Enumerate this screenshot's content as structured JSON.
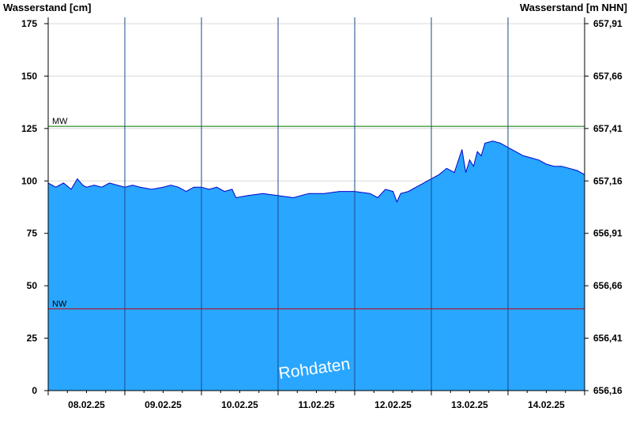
{
  "chart_data": {
    "type": "area",
    "ylabel": "Wasserstand [cm]",
    "ylabel_right": "Wasserstand [m NHN]",
    "ylim": [
      0,
      178
    ],
    "yticks": [
      0,
      25,
      50,
      75,
      100,
      125,
      150,
      175
    ],
    "yticks_right": [
      "656,16",
      "656,41",
      "656,66",
      "656,91",
      "657,16",
      "657,41",
      "657,66",
      "657,91"
    ],
    "x_dates": [
      "08.02.25",
      "09.02.25",
      "10.02.25",
      "11.02.25",
      "12.02.25",
      "13.02.25",
      "14.02.25"
    ],
    "xlim_days": [
      0,
      7
    ],
    "grid": true,
    "fill_color": "#29a6ff",
    "line_color": "#0000cc",
    "reference_lines": [
      {
        "label": "MW",
        "value": 126,
        "color": "#007000"
      },
      {
        "label": "NW",
        "value": 39,
        "color": "#cc0000"
      }
    ],
    "watermark": "Rohdaten",
    "series": [
      {
        "x": [
          0.0,
          0.1,
          0.2,
          0.3,
          0.38,
          0.45,
          0.5,
          0.6,
          0.7,
          0.8,
          0.9,
          1.0,
          1.1,
          1.2,
          1.35,
          1.5,
          1.6,
          1.7,
          1.8,
          1.9,
          2.0,
          2.1,
          2.2,
          2.3,
          2.4,
          2.45,
          2.6,
          2.8,
          3.0,
          3.2,
          3.4,
          3.6,
          3.8,
          4.0,
          4.2,
          4.3,
          4.4,
          4.5,
          4.55,
          4.6,
          4.7,
          4.8,
          4.9,
          5.0,
          5.1,
          5.2,
          5.3,
          5.4,
          5.45,
          5.5,
          5.55,
          5.6,
          5.65,
          5.7,
          5.8,
          5.9,
          6.0,
          6.1,
          6.2,
          6.3,
          6.4,
          6.5,
          6.6,
          6.7,
          6.8,
          6.9,
          7.0
        ],
        "y": [
          99,
          97,
          99,
          96,
          101,
          98,
          97,
          98,
          97,
          99,
          98,
          97,
          98,
          97,
          96,
          97,
          98,
          97,
          95,
          97,
          97,
          96,
          97,
          95,
          96,
          92,
          93,
          94,
          93,
          92,
          94,
          94,
          95,
          95,
          94,
          92,
          96,
          95,
          90,
          94,
          95,
          97,
          99,
          101,
          103,
          106,
          104,
          115,
          104,
          110,
          107,
          114,
          112,
          118,
          119,
          118,
          116,
          114,
          112,
          111,
          110,
          108,
          107,
          107,
          106,
          105,
          103
        ]
      }
    ]
  }
}
